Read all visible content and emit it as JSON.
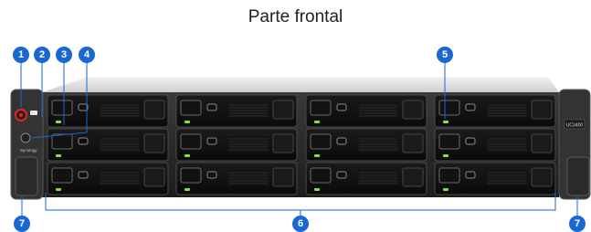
{
  "page": {
    "title": "Parte frontal"
  },
  "device": {
    "model_badge": "UC3400",
    "brand": "Synology",
    "bay_count": 12
  },
  "callouts": [
    {
      "num": "1"
    },
    {
      "num": "2"
    },
    {
      "num": "3"
    },
    {
      "num": "4"
    },
    {
      "num": "5"
    },
    {
      "num": "6"
    },
    {
      "num": "7"
    },
    {
      "num": "7"
    }
  ],
  "colors": {
    "accent": "#1a67d2",
    "status_led": "#7ee04a",
    "power_led": "#e02424"
  }
}
